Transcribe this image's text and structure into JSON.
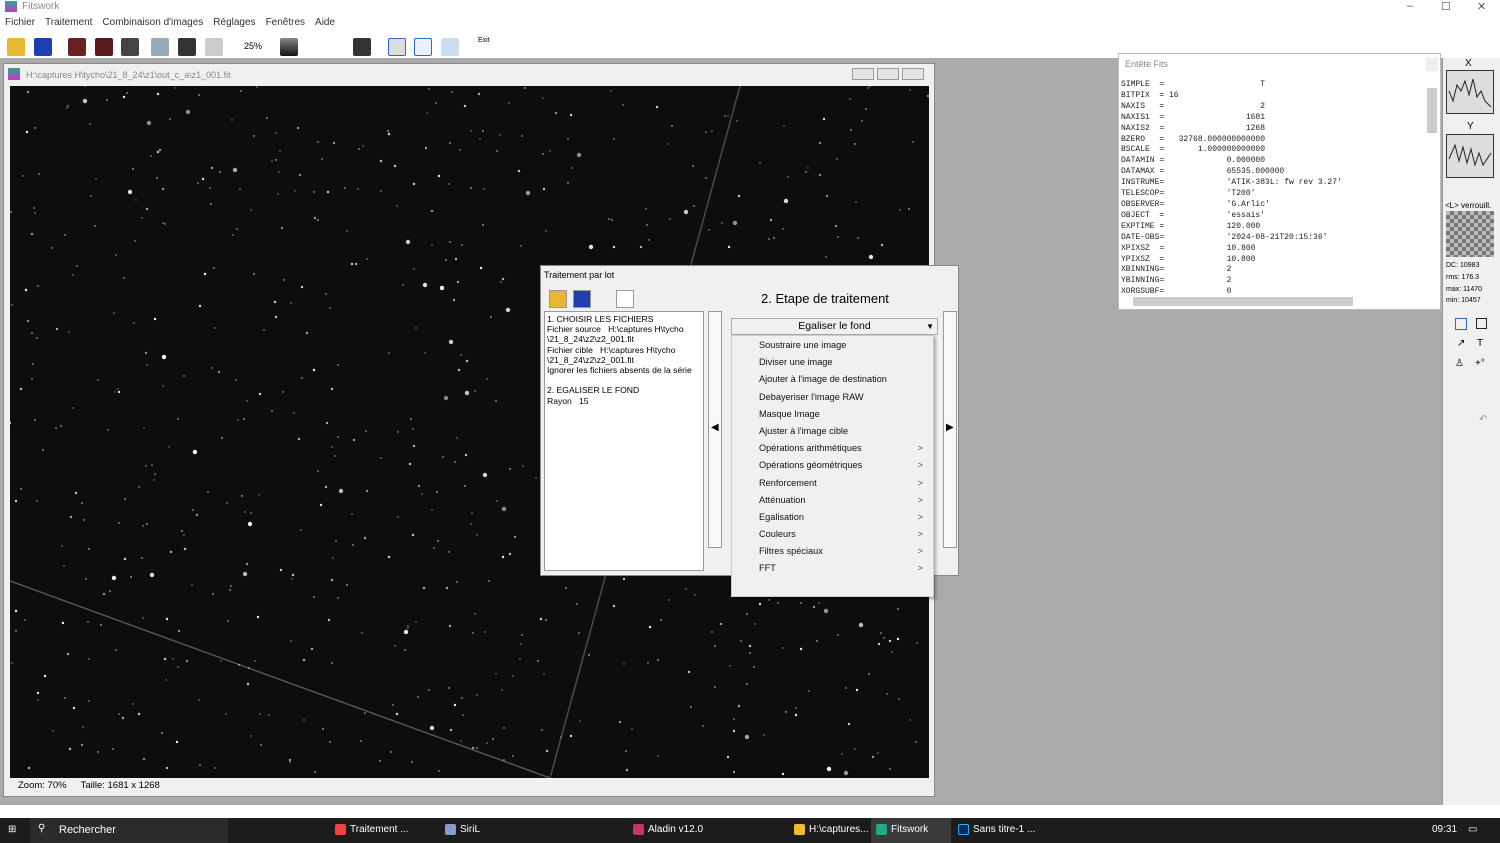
{
  "app": {
    "title": "Fitswork",
    "controls": [
      "–",
      "☐",
      "✕"
    ]
  },
  "menu": [
    "Fichier",
    "Traitement",
    "Combinaison d'images",
    "Réglages",
    "Fenêtres",
    "Aide"
  ],
  "toolbar": {
    "zoom_label": "25%",
    "exit_label": "Exit"
  },
  "image_window": {
    "title": "H:\\captures H\\tycho\\21_8_24\\z1\\out_c_a\\z1_001.fit",
    "zoom": "Zoom: 70%",
    "size": "Taille: 1681 x 1268"
  },
  "fits": {
    "title": "Entête Fits",
    "lines": [
      "SIMPLE  =                    T",
      "BITPIX  = 16",
      "NAXIS   =                    2",
      "NAXIS1  =                 1681",
      "NAXIS2  =                 1268",
      "BZERO   =   32768.000000000000",
      "BSCALE  =       1.000000000000",
      "DATAMIN =             0.000000",
      "DATAMAX =             65535.000000",
      "INSTRUME=             'ATIK-383L: fw rev 3.27'",
      "TELESCOP=             'T200'",
      "OBSERVER=             'G.Arlic'",
      "OBJECT  =             'essais'",
      "EXPTIME =             120.000",
      "DATE-OBS=             '2024-08-21T20:15:36'",
      "XPIXSZ  =             10.800",
      "YPIXSZ  =             10.800",
      "XBINNING=             2",
      "YBINNING=             2",
      "XORGSUBF=             0"
    ]
  },
  "side": {
    "x": "X",
    "y": "Y",
    "lock": "<L> verrouill.",
    "dc": "DC: 10983",
    "rms": "rms: 176.3",
    "max": "max: 11470",
    "min": "min: 10457"
  },
  "dialog": {
    "title": "Traitement par lot",
    "heading": "2. Etape de traitement",
    "steps": "1. CHOISIR LES FICHIERS\nFichier source   H:\\captures H\\tycho\n\\21_8_24\\z2\\z2_001.fit\nFichier cible   H:\\captures H\\tycho\n\\21_8_24\\z2\\z2_001.fit\nIgnorer les fichiers absents de la série\n\n2. EGALISER LE FOND\nRayon   15",
    "selected": "Egaliser le fond"
  },
  "dropdown": [
    {
      "label": "Soustraire une image",
      "sub": ""
    },
    {
      "label": "Diviser une image",
      "sub": ""
    },
    {
      "label": "Ajouter à l'image de destination",
      "sub": ""
    },
    {
      "label": "Debayeriser l'image RAW",
      "sub": ""
    },
    {
      "label": "Masque Image",
      "sub": ""
    },
    {
      "label": "Ajuster à l'image cible",
      "sub": ""
    },
    {
      "label": "Opérations arithmétiques",
      "sub": ">"
    },
    {
      "label": "Opérations géométriques",
      "sub": ">"
    },
    {
      "label": "Renforcement",
      "sub": ">"
    },
    {
      "label": "Atténuation",
      "sub": ">"
    },
    {
      "label": "Egalisation",
      "sub": ">"
    },
    {
      "label": "Couleurs",
      "sub": ">"
    },
    {
      "label": "Filtres spéciaux",
      "sub": ">"
    },
    {
      "label": "FFT",
      "sub": ">"
    }
  ],
  "taskbar": {
    "search": "Rechercher",
    "apps": [
      "Traitement ...",
      "SiriL",
      "Aladin v12.0",
      "H:\\captures...",
      "Fitswork",
      "Sans titre-1 ..."
    ],
    "time": "09:31"
  }
}
